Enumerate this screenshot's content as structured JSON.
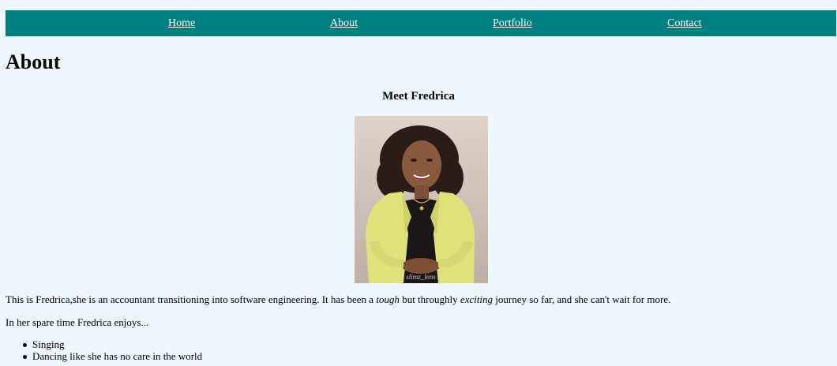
{
  "nav": {
    "items": [
      {
        "label": "Home"
      },
      {
        "label": "About"
      },
      {
        "label": "Portfolio"
      },
      {
        "label": "Contact"
      }
    ]
  },
  "main": {
    "title": "About",
    "subheading": "Meet Fredrica",
    "photo_watermark": "slimz_lens",
    "intro": {
      "part1": "This is Fredrica,she is an accountant transitioning into software engineering. It has been a ",
      "em1": "tough",
      "part2": " but throughly ",
      "em2": "exciting",
      "part3": " journey so far, and she can't wait for more."
    },
    "hobbies_intro": "In her spare time Fredrica enjoys...",
    "hobbies": [
      "Singing",
      "Dancing like she has no care in the world"
    ]
  },
  "colors": {
    "background": "#eff7fe",
    "nav_background": "#008080",
    "nav_link": "#ffffff",
    "blazer": "#dfe27a"
  }
}
